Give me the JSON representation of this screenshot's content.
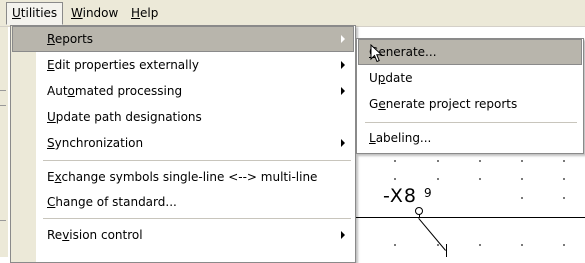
{
  "menubar": {
    "items": [
      {
        "u": "U",
        "rest": "tilities"
      },
      {
        "u": "W",
        "rest": "indow"
      },
      {
        "u": "H",
        "rest": "elp"
      }
    ]
  },
  "utilities_menu": {
    "items": [
      {
        "pre": "",
        "u": "R",
        "post": "eports"
      },
      {
        "pre": "",
        "u": "E",
        "post": "dit properties externally"
      },
      {
        "pre": "Aut",
        "u": "o",
        "post": "mated processing"
      },
      {
        "pre": "",
        "u": "U",
        "post": "pdate path designations"
      },
      {
        "pre": "",
        "u": "S",
        "post": "ynchronization"
      },
      {
        "pre": "E",
        "u": "x",
        "post": "change symbols single-line <--> multi-line"
      },
      {
        "pre": "",
        "u": "C",
        "post": "hange of standard..."
      },
      {
        "pre": "Re",
        "u": "v",
        "post": "ision control"
      }
    ]
  },
  "reports_submenu": {
    "items": [
      {
        "pre": "",
        "u": "G",
        "post": "enerate..."
      },
      {
        "pre": "U",
        "u": "p",
        "post": "date"
      },
      {
        "pre": "G",
        "u": "e",
        "post": "nerate project reports"
      },
      {
        "pre": "",
        "u": "L",
        "post": "abeling..."
      }
    ]
  },
  "schematic": {
    "device_tag": "-X8",
    "pin_number": "9"
  }
}
